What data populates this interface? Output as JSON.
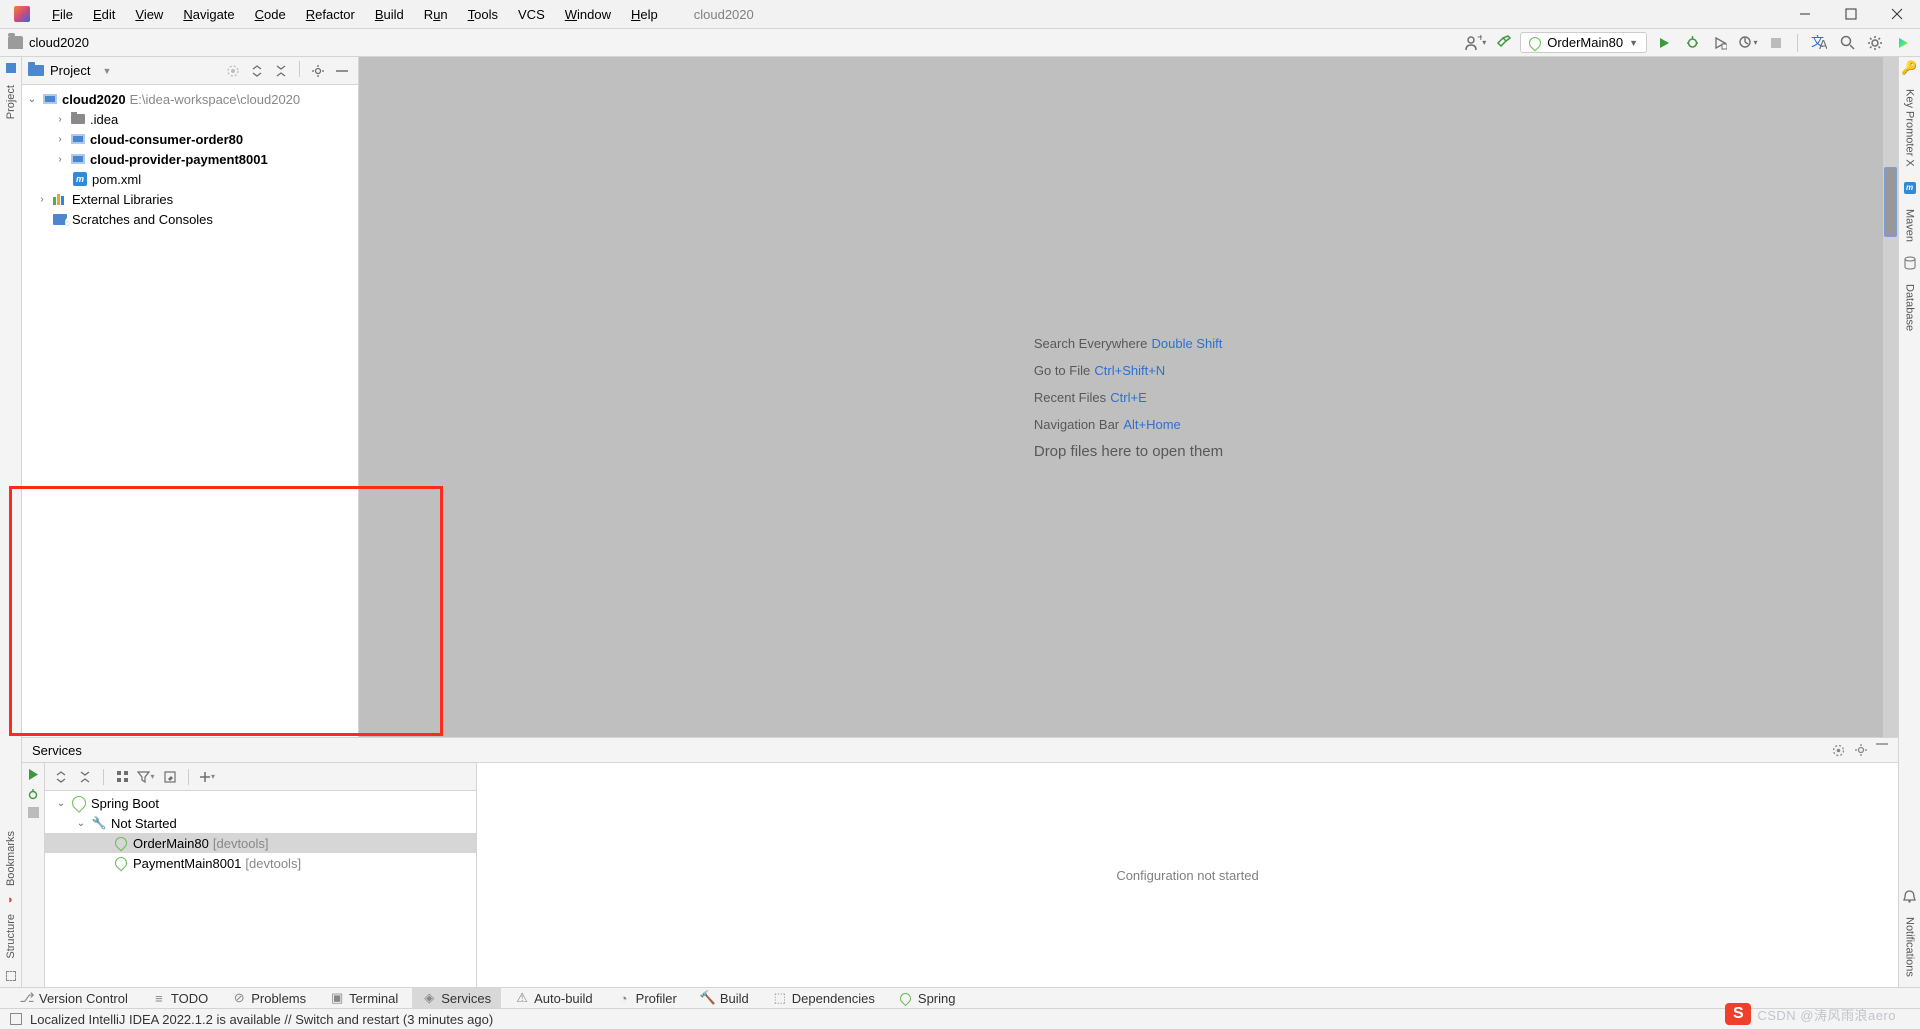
{
  "titlebar": {
    "project": "cloud2020"
  },
  "menu": {
    "file": "File",
    "edit": "Edit",
    "view": "View",
    "navigate": "Navigate",
    "code": "Code",
    "refactor": "Refactor",
    "build": "Build",
    "run": "Run",
    "tools": "Tools",
    "vcs": "VCS",
    "window": "Window",
    "help": "Help"
  },
  "navbar": {
    "project": "cloud2020",
    "run_config": "OrderMain80"
  },
  "project_panel": {
    "title": "Project",
    "root": {
      "name": "cloud2020",
      "path": "E:\\idea-workspace\\cloud2020"
    },
    "children": {
      "idea": ".idea",
      "order": "cloud-consumer-order80",
      "payment": "cloud-provider-payment8001",
      "pom": "pom.xml"
    },
    "ext_lib": "External Libraries",
    "scratches": "Scratches and Consoles"
  },
  "editor_hints": {
    "search": {
      "label": "Search Everywhere",
      "key": "Double Shift"
    },
    "gotofile": {
      "label": "Go to File",
      "key": "Ctrl+Shift+N"
    },
    "recent": {
      "label": "Recent Files",
      "key": "Ctrl+E"
    },
    "navbar": {
      "label": "Navigation Bar",
      "key": "Alt+Home"
    },
    "drop": "Drop files here to open them"
  },
  "services": {
    "title": "Services",
    "root": "Spring Boot",
    "group": "Not Started",
    "items": [
      {
        "name": "OrderMain80",
        "tag": "[devtools]"
      },
      {
        "name": "PaymentMain8001",
        "tag": "[devtools]"
      }
    ],
    "main_msg": "Configuration not started"
  },
  "left_rail": {
    "structure": "Structure",
    "bookmarks": "Bookmarks",
    "project": "Project"
  },
  "right_rail": {
    "keypromoter": "Key Promoter X",
    "maven": "Maven",
    "database": "Database",
    "notifications": "Notifications"
  },
  "tool_tabs": {
    "version": "Version Control",
    "todo": "TODO",
    "problems": "Problems",
    "terminal": "Terminal",
    "services": "Services",
    "autobuild": "Auto-build",
    "profiler": "Profiler",
    "buildt": "Build",
    "deps": "Dependencies",
    "spring": "Spring"
  },
  "status": {
    "msg": "Localized IntelliJ IDEA 2022.1.2 is available // Switch and restart (3 minutes ago)"
  },
  "watermark": {
    "csdn": "S",
    "text": "CSDN @涛风雨浪aero"
  }
}
